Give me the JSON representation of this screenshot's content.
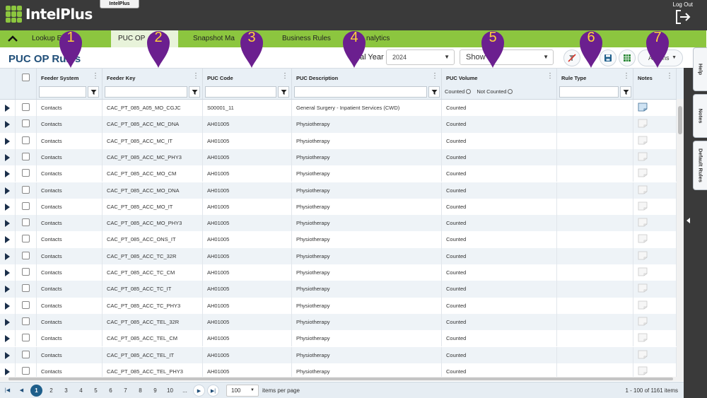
{
  "app": {
    "brand": "IntelPlus",
    "window_tab": "IntelPlus",
    "logout_label": "Log Out"
  },
  "nav": {
    "tabs": [
      {
        "label": "Lookup Editor"
      },
      {
        "label": "PUC OP"
      },
      {
        "label": "Snapshot Ma"
      },
      {
        "label": "Business Rules"
      },
      {
        "label": "nalytics"
      }
    ],
    "active_index": 1
  },
  "toolbar": {
    "page_title": "PUC OP Rules",
    "fiscal_year_label": "al Year",
    "fiscal_year_value": "2024",
    "show_label": "Show",
    "actions_label": "Actions"
  },
  "grid": {
    "columns": [
      {
        "title": ""
      },
      {
        "title": ""
      },
      {
        "title": "Feeder System"
      },
      {
        "title": "Feeder Key"
      },
      {
        "title": "PUC Code"
      },
      {
        "title": "PUC Description"
      },
      {
        "title": "PUC Volume"
      },
      {
        "title": "Rule Type"
      },
      {
        "title": "Notes"
      }
    ],
    "puc_volume_filter": {
      "counted": "Counted",
      "not_counted": "Not Counted"
    },
    "rows": [
      {
        "feeder_system": "Contacts",
        "feeder_key": "CAC_PT_085_A05_MO_CGJC",
        "puc_code": "S00001_11",
        "puc_description": "General Surgery - Inpatient Services (CWD)",
        "puc_volume": "Counted",
        "rule_type": "",
        "has_note": true
      },
      {
        "feeder_system": "Contacts",
        "feeder_key": "CAC_PT_085_ACC_MC_DNA",
        "puc_code": "AH01005",
        "puc_description": "Physiotherapy",
        "puc_volume": "Counted",
        "rule_type": "",
        "has_note": false
      },
      {
        "feeder_system": "Contacts",
        "feeder_key": "CAC_PT_085_ACC_MC_IT",
        "puc_code": "AH01005",
        "puc_description": "Physiotherapy",
        "puc_volume": "Counted",
        "rule_type": "",
        "has_note": false
      },
      {
        "feeder_system": "Contacts",
        "feeder_key": "CAC_PT_085_ACC_MC_PHY3",
        "puc_code": "AH01005",
        "puc_description": "Physiotherapy",
        "puc_volume": "Counted",
        "rule_type": "",
        "has_note": false
      },
      {
        "feeder_system": "Contacts",
        "feeder_key": "CAC_PT_085_ACC_MO_CM",
        "puc_code": "AH01005",
        "puc_description": "Physiotherapy",
        "puc_volume": "Counted",
        "rule_type": "",
        "has_note": false
      },
      {
        "feeder_system": "Contacts",
        "feeder_key": "CAC_PT_085_ACC_MO_DNA",
        "puc_code": "AH01005",
        "puc_description": "Physiotherapy",
        "puc_volume": "Counted",
        "rule_type": "",
        "has_note": false
      },
      {
        "feeder_system": "Contacts",
        "feeder_key": "CAC_PT_085_ACC_MO_IT",
        "puc_code": "AH01005",
        "puc_description": "Physiotherapy",
        "puc_volume": "Counted",
        "rule_type": "",
        "has_note": false
      },
      {
        "feeder_system": "Contacts",
        "feeder_key": "CAC_PT_085_ACC_MO_PHY3",
        "puc_code": "AH01005",
        "puc_description": "Physiotherapy",
        "puc_volume": "Counted",
        "rule_type": "",
        "has_note": false
      },
      {
        "feeder_system": "Contacts",
        "feeder_key": "CAC_PT_085_ACC_ONS_IT",
        "puc_code": "AH01005",
        "puc_description": "Physiotherapy",
        "puc_volume": "Counted",
        "rule_type": "",
        "has_note": false
      },
      {
        "feeder_system": "Contacts",
        "feeder_key": "CAC_PT_085_ACC_TC_32R",
        "puc_code": "AH01005",
        "puc_description": "Physiotherapy",
        "puc_volume": "Counted",
        "rule_type": "",
        "has_note": false
      },
      {
        "feeder_system": "Contacts",
        "feeder_key": "CAC_PT_085_ACC_TC_CM",
        "puc_code": "AH01005",
        "puc_description": "Physiotherapy",
        "puc_volume": "Counted",
        "rule_type": "",
        "has_note": false
      },
      {
        "feeder_system": "Contacts",
        "feeder_key": "CAC_PT_085_ACC_TC_IT",
        "puc_code": "AH01005",
        "puc_description": "Physiotherapy",
        "puc_volume": "Counted",
        "rule_type": "",
        "has_note": false
      },
      {
        "feeder_system": "Contacts",
        "feeder_key": "CAC_PT_085_ACC_TC_PHY3",
        "puc_code": "AH01005",
        "puc_description": "Physiotherapy",
        "puc_volume": "Counted",
        "rule_type": "",
        "has_note": false
      },
      {
        "feeder_system": "Contacts",
        "feeder_key": "CAC_PT_085_ACC_TEL_32R",
        "puc_code": "AH01005",
        "puc_description": "Physiotherapy",
        "puc_volume": "Counted",
        "rule_type": "",
        "has_note": false
      },
      {
        "feeder_system": "Contacts",
        "feeder_key": "CAC_PT_085_ACC_TEL_CM",
        "puc_code": "AH01005",
        "puc_description": "Physiotherapy",
        "puc_volume": "Counted",
        "rule_type": "",
        "has_note": false
      },
      {
        "feeder_system": "Contacts",
        "feeder_key": "CAC_PT_085_ACC_TEL_IT",
        "puc_code": "AH01005",
        "puc_description": "Physiotherapy",
        "puc_volume": "Counted",
        "rule_type": "",
        "has_note": false
      },
      {
        "feeder_system": "Contacts",
        "feeder_key": "CAC_PT_085_ACC_TEL_PHY3",
        "puc_code": "AH01005",
        "puc_description": "Physiotherapy",
        "puc_volume": "Counted",
        "rule_type": "",
        "has_note": false
      }
    ]
  },
  "side_tabs": [
    "Help",
    "Notes",
    "Default Rules"
  ],
  "pager": {
    "pages": [
      "1",
      "2",
      "3",
      "4",
      "5",
      "6",
      "7",
      "8",
      "9",
      "10",
      "..."
    ],
    "current_page": "1",
    "page_size": "100",
    "page_size_label": "items per page",
    "info": "1 - 100 of 1161 items"
  },
  "callouts": [
    "1",
    "2",
    "3",
    "4",
    "5",
    "6",
    "7"
  ],
  "colors": {
    "header_bg": "#3a3a3a",
    "nav_green": "#8cc63f",
    "title_blue": "#1f4e78",
    "callout_purple": "#6b1f8f",
    "callout_text": "#ffd23a"
  }
}
